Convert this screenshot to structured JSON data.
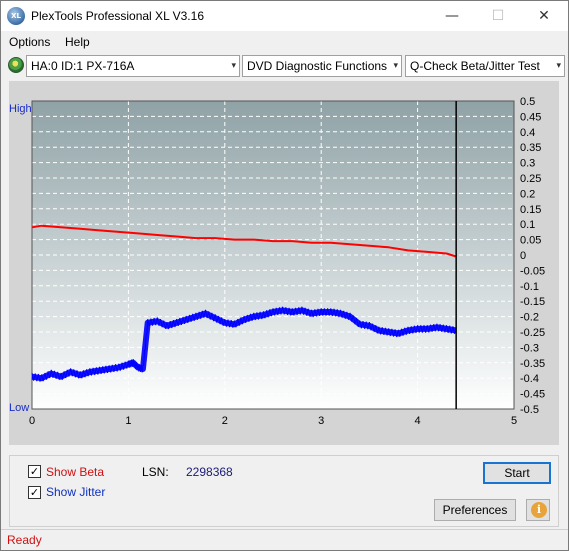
{
  "window": {
    "title": "PlexTools Professional XL V3.16",
    "app_icon_text": "XL",
    "min_glyph": "—",
    "max_glyph": "☐",
    "close_glyph": "✕"
  },
  "menu": {
    "options": "Options",
    "help": "Help"
  },
  "toolbar": {
    "drive": "HA:0 ID:1  PX-716A",
    "function": "DVD Diagnostic Functions",
    "test": "Q-Check Beta/Jitter Test",
    "arrow_glyph": "▾"
  },
  "chart_data": {
    "type": "line",
    "left_axis_labels": {
      "top": "High",
      "bottom": "Low"
    },
    "x_ticks": [
      "0",
      "1",
      "2",
      "3",
      "4",
      "5"
    ],
    "xlim": [
      0,
      5
    ],
    "ylim": [
      -0.5,
      0.5
    ],
    "y_ticks": [
      "0.5",
      "0.45",
      "0.4",
      "0.35",
      "0.3",
      "0.25",
      "0.2",
      "0.15",
      "0.1",
      "0.05",
      "0",
      "-0.05",
      "-0.1",
      "-0.15",
      "-0.2",
      "-0.25",
      "-0.3",
      "-0.35",
      "-0.4",
      "-0.45",
      "-0.5"
    ],
    "end_marker_x": 4.4,
    "grid": true,
    "series": [
      {
        "color": "#ff0000",
        "x": [
          0,
          0.1,
          0.3,
          0.5,
          0.7,
          0.9,
          1.1,
          1.3,
          1.5,
          1.7,
          1.9,
          2.1,
          2.3,
          2.5,
          2.7,
          2.9,
          3.1,
          3.3,
          3.5,
          3.7,
          3.9,
          4.1,
          4.3,
          4.4
        ],
        "y": [
          0.09,
          0.095,
          0.09,
          0.085,
          0.08,
          0.075,
          0.07,
          0.065,
          0.06,
          0.055,
          0.055,
          0.05,
          0.05,
          0.045,
          0.045,
          0.04,
          0.04,
          0.035,
          0.03,
          0.025,
          0.015,
          0.01,
          0.005,
          -0.005
        ]
      },
      {
        "color": "#0000ff",
        "x": [
          0,
          0.1,
          0.2,
          0.3,
          0.4,
          0.5,
          0.6,
          0.7,
          0.8,
          0.9,
          1.0,
          1.05,
          1.1,
          1.15,
          1.2,
          1.3,
          1.4,
          1.5,
          1.6,
          1.7,
          1.8,
          1.9,
          2.0,
          2.1,
          2.2,
          2.3,
          2.4,
          2.5,
          2.6,
          2.7,
          2.8,
          2.9,
          3.0,
          3.1,
          3.2,
          3.3,
          3.4,
          3.5,
          3.6,
          3.7,
          3.8,
          3.9,
          4.0,
          4.1,
          4.2,
          4.3,
          4.4
        ],
        "y": [
          -0.395,
          -0.4,
          -0.385,
          -0.395,
          -0.38,
          -0.39,
          -0.38,
          -0.375,
          -0.37,
          -0.365,
          -0.355,
          -0.35,
          -0.365,
          -0.37,
          -0.22,
          -0.215,
          -0.23,
          -0.22,
          -0.21,
          -0.2,
          -0.19,
          -0.205,
          -0.22,
          -0.225,
          -0.21,
          -0.2,
          -0.195,
          -0.185,
          -0.18,
          -0.185,
          -0.18,
          -0.19,
          -0.185,
          -0.185,
          -0.19,
          -0.2,
          -0.225,
          -0.23,
          -0.245,
          -0.25,
          -0.255,
          -0.245,
          -0.24,
          -0.24,
          -0.235,
          -0.24,
          -0.245
        ]
      }
    ]
  },
  "bottom": {
    "show_beta": "Show Beta",
    "show_jitter": "Show Jitter",
    "check_glyph": "✓",
    "lsn_label": "LSN:",
    "lsn_value": "2298368",
    "start": "Start",
    "preferences": "Preferences",
    "info_glyph": "i"
  },
  "status": {
    "text": "Ready"
  }
}
